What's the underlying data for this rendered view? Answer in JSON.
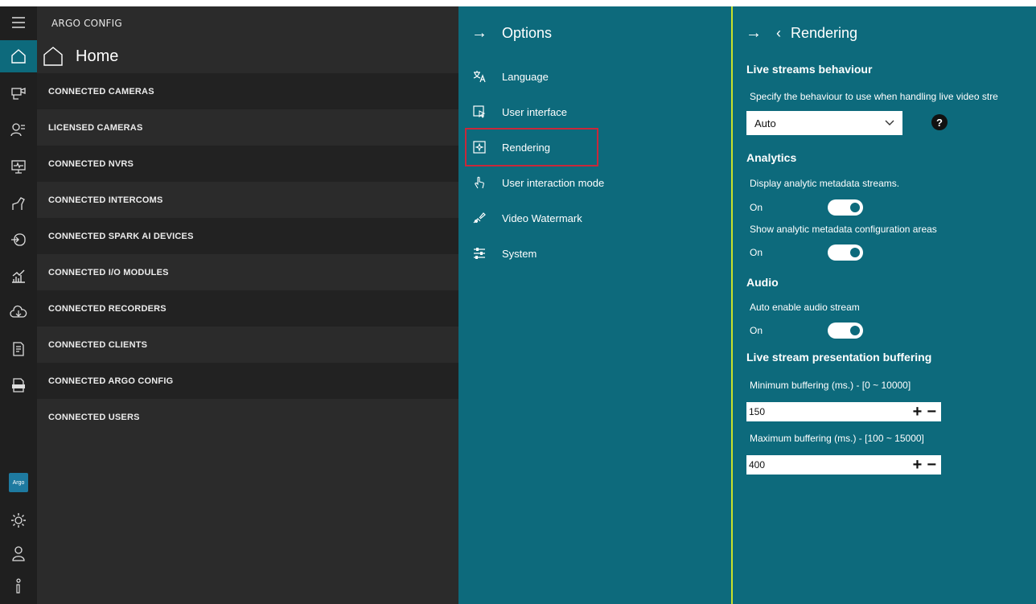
{
  "app": {
    "title": "ARGO CONFIG"
  },
  "home": {
    "title": "Home",
    "items": [
      {
        "label": "CONNECTED CAMERAS"
      },
      {
        "label": "LICENSED CAMERAS"
      },
      {
        "label": "CONNECTED NVRS"
      },
      {
        "label": "CONNECTED INTERCOMS"
      },
      {
        "label": "CONNECTED SPARK AI DEVICES"
      },
      {
        "label": "CONNECTED I/O MODULES"
      },
      {
        "label": "CONNECTED RECORDERS"
      },
      {
        "label": "CONNECTED CLIENTS"
      },
      {
        "label": "CONNECTED ARGO CONFIG"
      },
      {
        "label": "CONNECTED USERS"
      }
    ]
  },
  "rail": {
    "logo_text": "Argo",
    "icons": [
      "menu-icon",
      "home-icon",
      "camera-icon",
      "users-icon",
      "monitor-icon",
      "intercom-icon",
      "device-icon",
      "analytics-icon",
      "cloud-icon",
      "document-icon",
      "log-icon",
      "settings-icon",
      "user-icon",
      "info-icon"
    ]
  },
  "options": {
    "title": "Options",
    "items": [
      {
        "label": "Language",
        "icon": "language-icon"
      },
      {
        "label": "User interface",
        "icon": "user-interface-icon"
      },
      {
        "label": "Rendering",
        "icon": "rendering-icon",
        "selected": true
      },
      {
        "label": "User interaction mode",
        "icon": "touch-icon"
      },
      {
        "label": "Video Watermark",
        "icon": "watermark-icon"
      },
      {
        "label": "System",
        "icon": "system-icon"
      }
    ]
  },
  "rendering": {
    "title": "Rendering",
    "live_streams": {
      "heading": "Live streams behaviour",
      "description": "Specify the behaviour to use when handling live video stre",
      "selected": "Auto"
    },
    "analytics": {
      "heading": "Analytics",
      "display_label": "Display analytic metadata streams.",
      "display_state": "On",
      "config_label": "Show analytic metadata configuration areas",
      "config_state": "On"
    },
    "audio": {
      "heading": "Audio",
      "auto_label": "Auto enable audio stream",
      "auto_state": "On"
    },
    "buffering": {
      "heading": "Live stream presentation buffering",
      "min_label": "Minimum buffering (ms.) - [0 ~ 10000]",
      "min_value": "150",
      "max_label": "Maximum buffering (ms.) - [100 ~ 15000]",
      "max_value": "400"
    }
  },
  "colors": {
    "panel": "#0d6a7c",
    "accent_divider": "#c9e22a",
    "selection_outline": "#c8283a"
  }
}
